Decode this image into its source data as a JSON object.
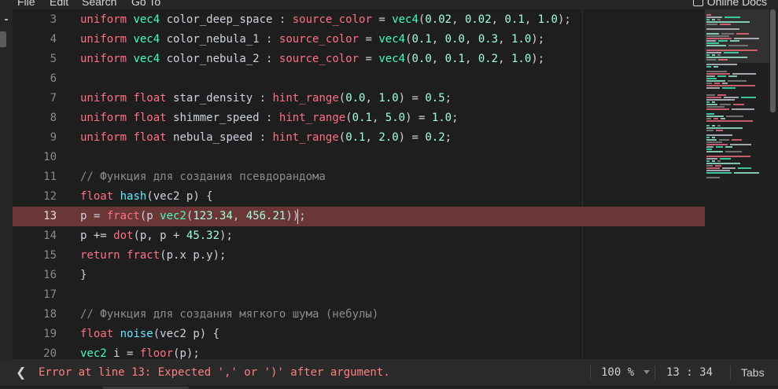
{
  "menubar": {
    "items": [
      "File",
      "Edit",
      "Search",
      "Go To"
    ],
    "online_docs": "Online Docs"
  },
  "editor": {
    "error_line": 13,
    "lines": [
      {
        "num": "3",
        "tokens": [
          {
            "t": "uniform",
            "c": "kw"
          },
          {
            "t": " "
          },
          {
            "t": "vec4",
            "c": "ty"
          },
          {
            "t": " color_deep_space : "
          },
          {
            "t": "source_color",
            "c": "kw"
          },
          {
            "t": " = "
          },
          {
            "t": "vec4",
            "c": "ty"
          },
          {
            "t": "("
          },
          {
            "t": "0.02",
            "c": "num"
          },
          {
            "t": ", "
          },
          {
            "t": "0.02",
            "c": "num"
          },
          {
            "t": ", "
          },
          {
            "t": "0.1",
            "c": "num"
          },
          {
            "t": ", "
          },
          {
            "t": "1.0",
            "c": "num"
          },
          {
            "t": ");"
          }
        ]
      },
      {
        "num": "4",
        "tokens": [
          {
            "t": "uniform",
            "c": "kw"
          },
          {
            "t": " "
          },
          {
            "t": "vec4",
            "c": "ty"
          },
          {
            "t": " color_nebula_1 : "
          },
          {
            "t": "source_color",
            "c": "kw"
          },
          {
            "t": " = "
          },
          {
            "t": "vec4",
            "c": "ty"
          },
          {
            "t": "("
          },
          {
            "t": "0.1",
            "c": "num"
          },
          {
            "t": ", "
          },
          {
            "t": "0.0",
            "c": "num"
          },
          {
            "t": ", "
          },
          {
            "t": "0.3",
            "c": "num"
          },
          {
            "t": ", "
          },
          {
            "t": "1.0",
            "c": "num"
          },
          {
            "t": ");"
          }
        ]
      },
      {
        "num": "5",
        "tokens": [
          {
            "t": "uniform",
            "c": "kw"
          },
          {
            "t": " "
          },
          {
            "t": "vec4",
            "c": "ty"
          },
          {
            "t": " color_nebula_2 : "
          },
          {
            "t": "source_color",
            "c": "kw"
          },
          {
            "t": " = "
          },
          {
            "t": "vec4",
            "c": "ty"
          },
          {
            "t": "("
          },
          {
            "t": "0.0",
            "c": "num"
          },
          {
            "t": ", "
          },
          {
            "t": "0.1",
            "c": "num"
          },
          {
            "t": ", "
          },
          {
            "t": "0.2",
            "c": "num"
          },
          {
            "t": ", "
          },
          {
            "t": "1.0",
            "c": "num"
          },
          {
            "t": ");"
          }
        ]
      },
      {
        "num": "6",
        "tokens": []
      },
      {
        "num": "7",
        "tokens": [
          {
            "t": "uniform",
            "c": "kw"
          },
          {
            "t": " "
          },
          {
            "t": "float",
            "c": "kw"
          },
          {
            "t": " star_density : "
          },
          {
            "t": "hint_range",
            "c": "kw"
          },
          {
            "t": "("
          },
          {
            "t": "0.0",
            "c": "num"
          },
          {
            "t": ", "
          },
          {
            "t": "1.0",
            "c": "num"
          },
          {
            "t": ") = "
          },
          {
            "t": "0.5",
            "c": "num"
          },
          {
            "t": ";"
          }
        ]
      },
      {
        "num": "8",
        "tokens": [
          {
            "t": "uniform",
            "c": "kw"
          },
          {
            "t": " "
          },
          {
            "t": "float",
            "c": "kw"
          },
          {
            "t": " shimmer_speed : "
          },
          {
            "t": "hint_range",
            "c": "kw"
          },
          {
            "t": "("
          },
          {
            "t": "0.1",
            "c": "num"
          },
          {
            "t": ", "
          },
          {
            "t": "5.0",
            "c": "num"
          },
          {
            "t": ") = "
          },
          {
            "t": "1.0",
            "c": "num"
          },
          {
            "t": ";"
          }
        ]
      },
      {
        "num": "9",
        "tokens": [
          {
            "t": "uniform",
            "c": "kw"
          },
          {
            "t": " "
          },
          {
            "t": "float",
            "c": "kw"
          },
          {
            "t": " nebula_speed : "
          },
          {
            "t": "hint_range",
            "c": "kw"
          },
          {
            "t": "("
          },
          {
            "t": "0.1",
            "c": "num"
          },
          {
            "t": ", "
          },
          {
            "t": "2.0",
            "c": "num"
          },
          {
            "t": ") = "
          },
          {
            "t": "0.2",
            "c": "num"
          },
          {
            "t": ";"
          }
        ]
      },
      {
        "num": "10",
        "tokens": []
      },
      {
        "num": "11",
        "tokens": [
          {
            "t": "// Функция для создания псевдорандома",
            "c": "cm"
          }
        ]
      },
      {
        "num": "12",
        "tokens": [
          {
            "t": "float",
            "c": "kw"
          },
          {
            "t": " "
          },
          {
            "t": "hash",
            "c": "fn"
          },
          {
            "t": "(vec2 p) {"
          }
        ]
      },
      {
        "num": "13",
        "tokens": [
          {
            "t": "p = "
          },
          {
            "t": "fract",
            "c": "bi"
          },
          {
            "t": "(p "
          },
          {
            "t": "vec2",
            "c": "ty"
          },
          {
            "t": "("
          },
          {
            "t": "123.34",
            "c": "num"
          },
          {
            "t": ", "
          },
          {
            "t": "456.21",
            "c": "num"
          },
          {
            "t": "));"
          }
        ]
      },
      {
        "num": "14",
        "tokens": [
          {
            "t": "p += "
          },
          {
            "t": "dot",
            "c": "bi"
          },
          {
            "t": "(p, p + "
          },
          {
            "t": "45.32",
            "c": "num"
          },
          {
            "t": ");"
          }
        ]
      },
      {
        "num": "15",
        "tokens": [
          {
            "t": "return",
            "c": "kw"
          },
          {
            "t": " "
          },
          {
            "t": "fract",
            "c": "bi"
          },
          {
            "t": "(p.x p.y);"
          }
        ]
      },
      {
        "num": "16",
        "tokens": [
          {
            "t": "}"
          }
        ]
      },
      {
        "num": "17",
        "tokens": []
      },
      {
        "num": "18",
        "tokens": [
          {
            "t": "// Функция для создания мягкого шума (небулы)",
            "c": "cm"
          }
        ]
      },
      {
        "num": "19",
        "tokens": [
          {
            "t": "float",
            "c": "kw"
          },
          {
            "t": " "
          },
          {
            "t": "noise",
            "c": "fn"
          },
          {
            "t": "(vec2 p) {"
          }
        ]
      },
      {
        "num": "20",
        "tokens": [
          {
            "t": "vec2",
            "c": "ty"
          },
          {
            "t": " i = "
          },
          {
            "t": "floor",
            "c": "bi"
          },
          {
            "t": "(p);"
          }
        ]
      }
    ]
  },
  "statusbar": {
    "toggle_icon": "❮",
    "error_text": "Error at line 13: Expected ',' or ')' after argument.",
    "zoom": "100 %",
    "position": "13 :  34",
    "indent": "Tabs"
  },
  "colors": {
    "keyword": "#ff7085",
    "type": "#42ffc2",
    "function": "#66e6ff",
    "number": "#a1ffe0",
    "comment": "#8c8c8c",
    "error_line_bg": "#6b3636",
    "error_text": "#ff8080"
  }
}
